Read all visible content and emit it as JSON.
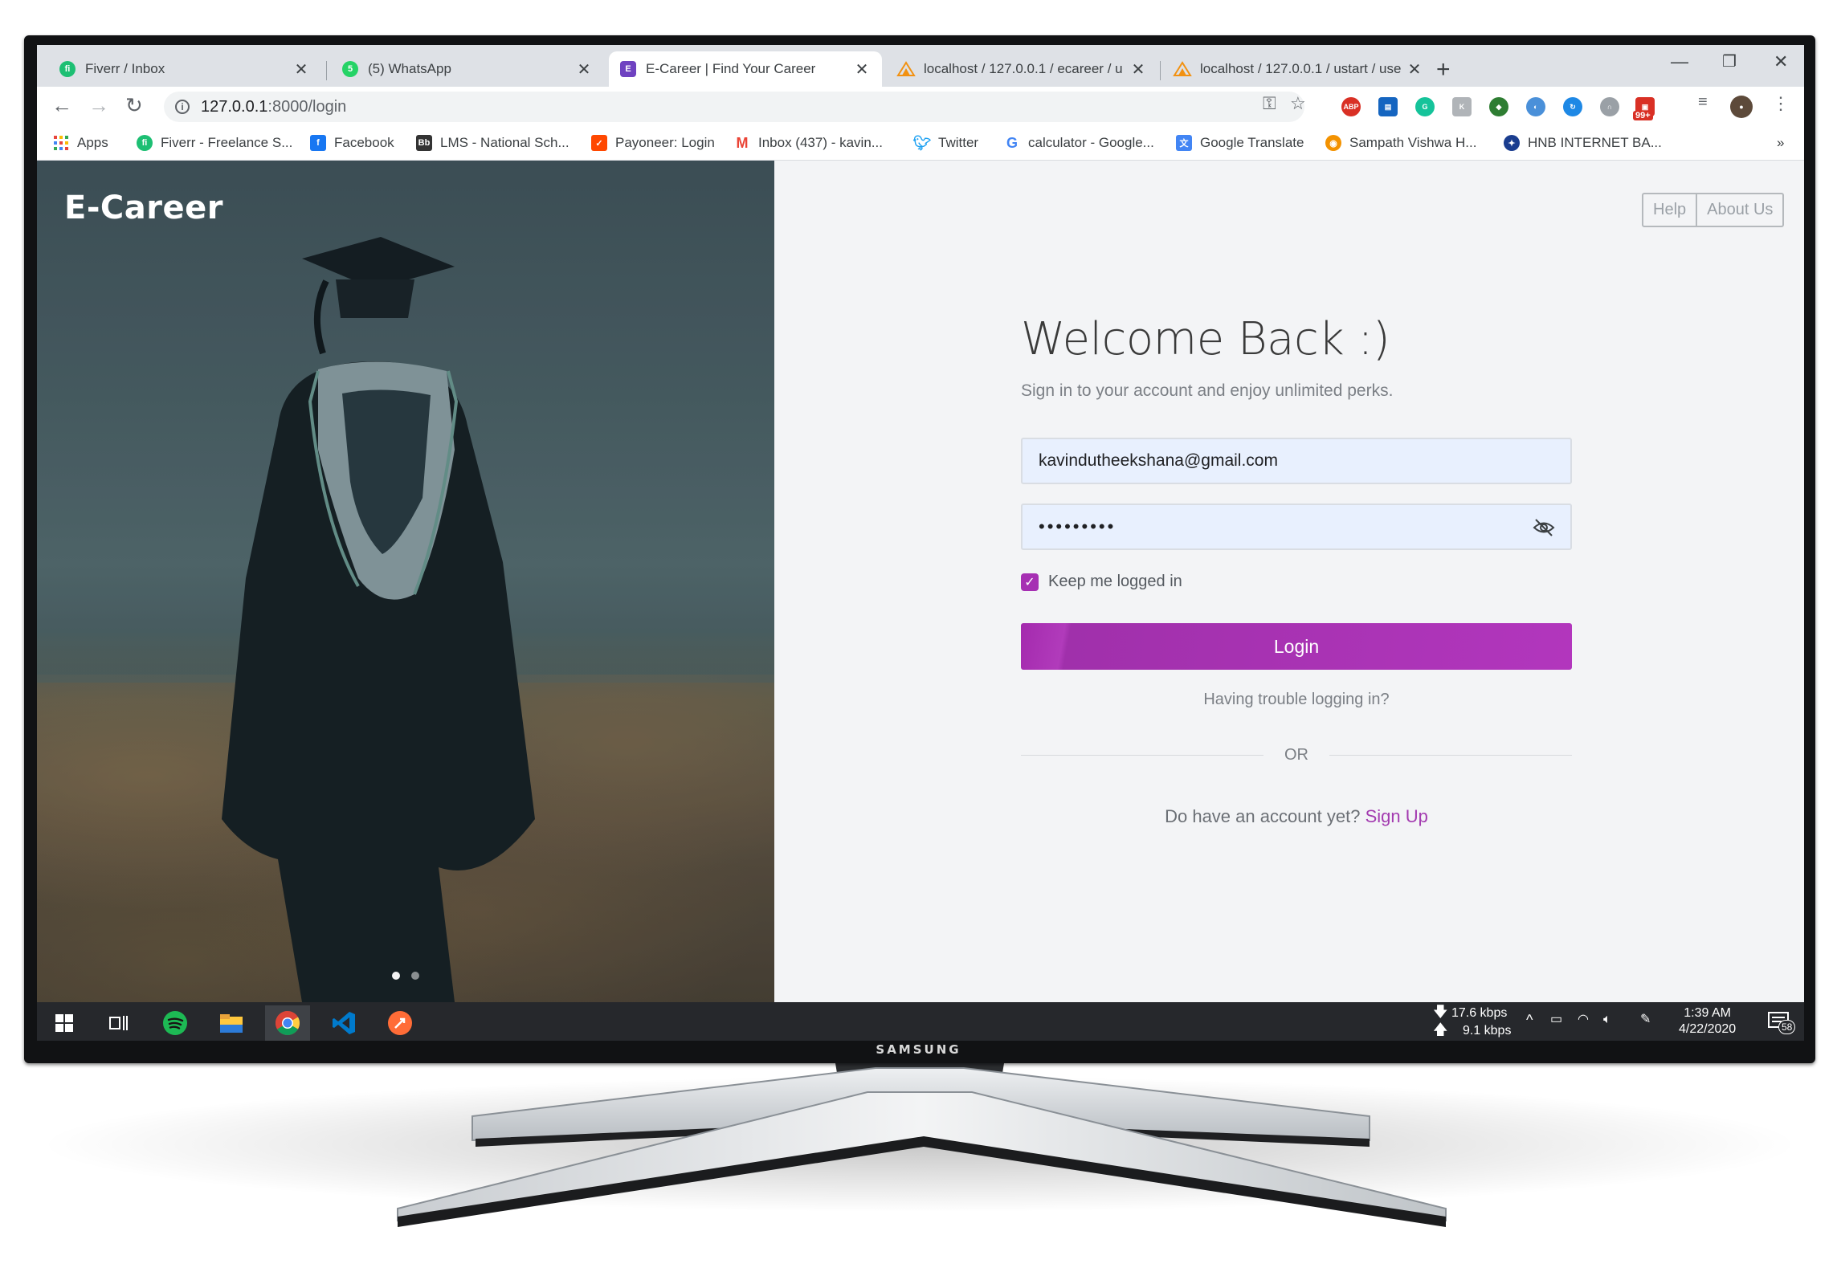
{
  "monitor": {
    "brand": "SAMSUNG"
  },
  "tabs": [
    {
      "title": "Fiverr / Inbox",
      "favicon": "fiverr-icon",
      "color": "#1dbf73",
      "glyph": "fi",
      "active": false
    },
    {
      "title": "(5) WhatsApp",
      "favicon": "whatsapp-icon",
      "color": "#25d366",
      "glyph": "5",
      "active": false
    },
    {
      "title": "E-Career | Find Your Career",
      "favicon": "ecareer-icon",
      "color": "#6f42c1",
      "glyph": "E",
      "active": true
    },
    {
      "title": "localhost / 127.0.0.1 / ecareer / u",
      "favicon": "phpmyadmin-icon",
      "color": "#f29111",
      "glyph": "",
      "active": false
    },
    {
      "title": "localhost / 127.0.0.1 / ustart / use",
      "favicon": "phpmyadmin-icon",
      "color": "#f29111",
      "glyph": "",
      "active": false
    }
  ],
  "toolbar": {
    "url_host": "127.0.0.1",
    "url_rest": ":8000/login"
  },
  "bookmarks": [
    {
      "label": "Apps",
      "icon": "apps-grid-icon",
      "color": "#e8453c"
    },
    {
      "label": "Fiverr - Freelance S...",
      "icon": "fiverr-icon",
      "color": "#1dbf73"
    },
    {
      "label": "Facebook",
      "icon": "facebook-icon",
      "color": "#1877f2"
    },
    {
      "label": "LMS - National Sch...",
      "icon": "lms-icon",
      "color": "#333333"
    },
    {
      "label": "Payoneer: Login",
      "icon": "payoneer-icon",
      "color": "#ff4800"
    },
    {
      "label": "Inbox (437) - kavin...",
      "icon": "gmail-icon",
      "color": "#ea4335"
    },
    {
      "label": "Twitter",
      "icon": "twitter-icon",
      "color": "#1da1f2"
    },
    {
      "label": "calculator - Google...",
      "icon": "google-icon",
      "color": "#4285f4"
    },
    {
      "label": "Google Translate",
      "icon": "translate-icon",
      "color": "#4285f4"
    },
    {
      "label": "Sampath Vishwa H...",
      "icon": "sampath-icon",
      "color": "#f39200"
    },
    {
      "label": "HNB INTERNET BA...",
      "icon": "hnb-icon",
      "color": "#1a3d8f"
    }
  ],
  "page": {
    "brand": "E-Career",
    "nav": {
      "help": "Help",
      "about": "About Us"
    },
    "heading": "Welcome Back :)",
    "subheading": "Sign in to your account and enjoy unlimited perks.",
    "email_value": "kavindutheekshana@gmail.com",
    "password_mask": "•••••••••",
    "remember_label": "Keep me logged in",
    "remember_checked": true,
    "login_label": "Login",
    "trouble_link": "Having trouble logging in?",
    "or_label": "OR",
    "signup_prompt": "Do have an account yet?",
    "signup_link": "Sign Up",
    "accent": "#a933b4"
  },
  "taskbar": {
    "net_down": "17.6 kbps",
    "net_up": "9.1 kbps",
    "time": "1:39 AM",
    "date": "4/22/2020",
    "notifications": "58"
  }
}
